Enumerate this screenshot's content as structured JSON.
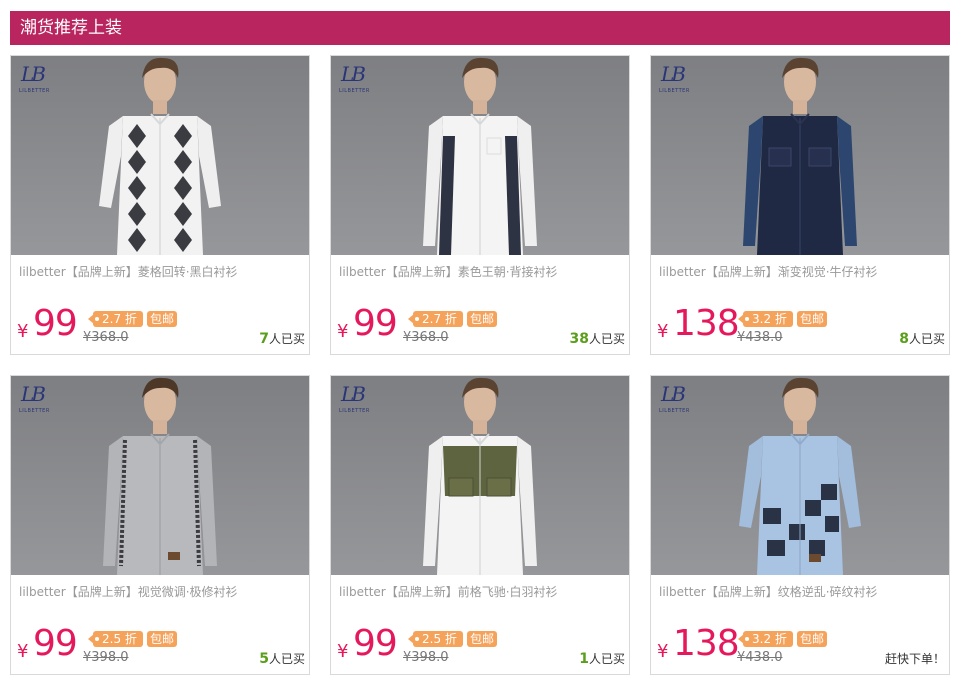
{
  "header": {
    "title": "潮货推荐上装",
    "bg_color": "#b8255f"
  },
  "brand": {
    "mark": "LB",
    "wordmark": "LILBETTER"
  },
  "colors": {
    "price": "#e5185c",
    "tag": "#f5a25b",
    "sold_count": "#5a9e1c"
  },
  "products": [
    {
      "title": "lilbetter【品牌上新】菱格回转·黑白衬衫",
      "currency": "¥",
      "price": "99",
      "discount": "2.7 折",
      "free_ship": "包邮",
      "original_price": "¥368.0",
      "sold_count": "7",
      "sold_suffix": "人已买",
      "shirt": "white-argyle"
    },
    {
      "title": "lilbetter【品牌上新】素色王朝·背接衬衫",
      "currency": "¥",
      "price": "99",
      "discount": "2.7 折",
      "free_ship": "包邮",
      "original_price": "¥368.0",
      "sold_count": "38",
      "sold_suffix": "人已买",
      "shirt": "white-navy-panels"
    },
    {
      "title": "lilbetter【品牌上新】渐变视觉·牛仔衬衫",
      "currency": "¥",
      "price": "138",
      "discount": "3.2 折",
      "free_ship": "包邮",
      "original_price": "¥438.0",
      "sold_count": "8",
      "sold_suffix": "人已买",
      "shirt": "navy-denim"
    },
    {
      "title": "lilbetter【品牌上新】视觉微调·极修衬衫",
      "currency": "¥",
      "price": "99",
      "discount": "2.5 折",
      "free_ship": "包邮",
      "original_price": "¥398.0",
      "sold_count": "5",
      "sold_suffix": "人已买",
      "shirt": "grey-stripe"
    },
    {
      "title": "lilbetter【品牌上新】前格飞驰·白羽衬衫",
      "currency": "¥",
      "price": "99",
      "discount": "2.5 折",
      "free_ship": "包邮",
      "original_price": "¥398.0",
      "sold_count": "1",
      "sold_suffix": "人已买",
      "shirt": "white-olive-yoke"
    },
    {
      "title": "lilbetter【品牌上新】纹格逆乱·碎纹衬衫",
      "currency": "¥",
      "price": "138",
      "discount": "3.2 折",
      "free_ship": "包邮",
      "original_price": "¥438.0",
      "sold_count": "",
      "sold_suffix": "赶快下单！",
      "shirt": "blue-check"
    }
  ]
}
